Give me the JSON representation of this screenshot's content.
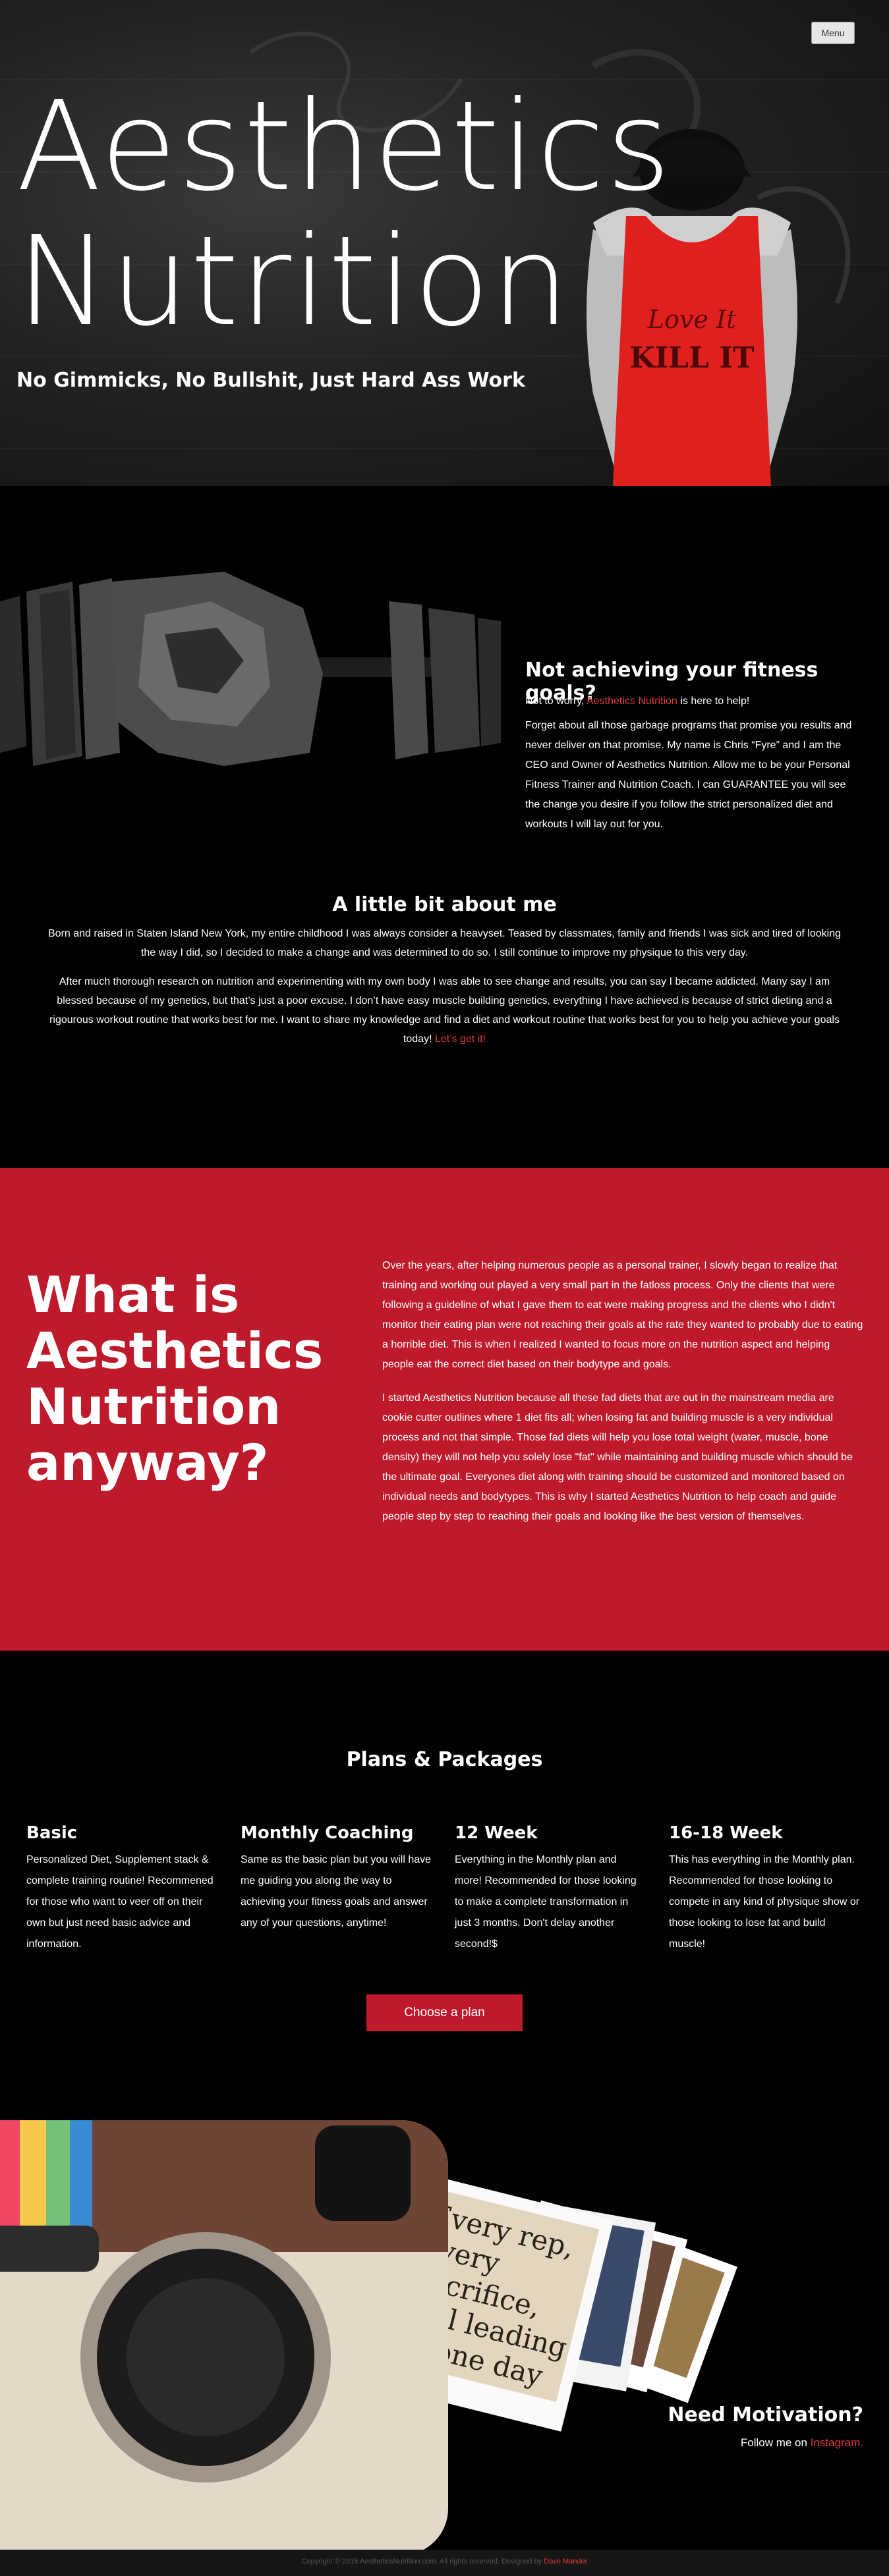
{
  "header": {
    "menu_label": "Menu"
  },
  "hero": {
    "title_line1": "Aesthetics",
    "title_line2": "Nutrition",
    "subtitle": "No Gimmicks, No Bullshit, Just Hard Ass Work",
    "shirt_text": "Love It KILL IT"
  },
  "intro": {
    "heading": "Not achieving your fitness goals?",
    "p1_before": "Not to worry, ",
    "p1_link": "Aesthetics Nutrition",
    "p1_after": " is here to help!",
    "p2": "Forget about all those garbage programs that promise you results and never deliver on that promise. My name is Chris “Fyre” and I am the CEO and Owner of Aesthetics Nutrition. Allow me to be your Personal Fitness Trainer and Nutrition Coach. I can GUARANTEE you will see the change you desire if you follow the strict personalized diet and workouts I will lay out for you."
  },
  "about": {
    "heading": "A little bit about me",
    "p1": "Born and raised in Staten Island New York, my entire childhood I was always consider a heavyset. Teased by classmates, family and friends I was sick and tired of looking the way I did, so I decided to make a change and was determined to do so. I still continue to improve my physique to this very day.",
    "p2": "After much thorough research on nutrition and experimenting with my own body I was able to see change and results, you can say I became addicted. Many say I am blessed because of my genetics, but that’s just a poor excuse. I don’t have easy muscle building genetics, everything I have achieved is because of strict dieting and a rigourous workout routine that works best for me. I want to share my knowledge and find a diet and workout routine that works best for you to help you achieve your goals today! ",
    "p2_link": "Let’s get it!"
  },
  "what": {
    "heading": "What is Aesthetics Nutrition anyway?",
    "p1": "Over the years, after helping numerous people as a personal trainer, I slowly began to realize that training and working out played a very small part in the fatloss process. Only the clients that were following a guideline of what I gave them to eat were making progress and the clients who I didn't monitor their eating plan were not reaching their goals at the rate they wanted to probably due to eating a horrible diet. This is when I realized I wanted to focus more on the nutrition aspect and helping people eat the correct diet based on their bodytype and goals.",
    "p2": "I started Aesthetics Nutrition because all these fad diets that are out in the mainstream media are cookie cutter outlines where 1 diet fits all; when losing fat and building muscle is a very individual process and not that simple. Those fad diets will help you lose total weight (water, muscle, bone density) they will not help you solely lose \"fat\" while maintaining and building muscle which should be the ultimate goal. Everyones diet along with training should be customized and monitored based on individual needs and bodytypes. This is why I started Aesthetics Nutrition to help coach and guide people step by step to reaching their goals and looking like the best version of themselves."
  },
  "plans": {
    "heading": "Plans & Packages",
    "items": [
      {
        "title": "Basic",
        "desc": "Personalized Diet, Supplement stack & complete training routine! Recommened for those who want to veer off on their own but just need basic advice and information."
      },
      {
        "title": "Monthly Coaching",
        "desc": "Same as the basic plan but you will have me guiding you along the way to achieving your fitness goals and answer any of your questions, anytime!"
      },
      {
        "title": "12 Week",
        "desc": "Everything in the Monthly plan and more! Recommended for those looking to make a complete transformation in just 3 months. Don't delay another second!$"
      },
      {
        "title": "16-18 Week",
        "desc": "This has everything in the Monthly plan. Recommended for those looking to compete in any kind of physique show or those looking to lose fat and build muscle!"
      }
    ],
    "button_label": "Choose a plan"
  },
  "insta": {
    "quote": "Every rep, every sacrifice, will leading to one day",
    "heading": "Need Motivation?",
    "follow_before": "Follow me on ",
    "follow_link": "Instagram."
  },
  "footer": {
    "text": "Copyright © 2015 AestheticsNutrition.com. All rights reserved. Designed by ",
    "link": "Dave Mander"
  },
  "colors": {
    "brand_red": "#be1a2b",
    "link_red": "#e33a3a",
    "background": "#000000"
  }
}
